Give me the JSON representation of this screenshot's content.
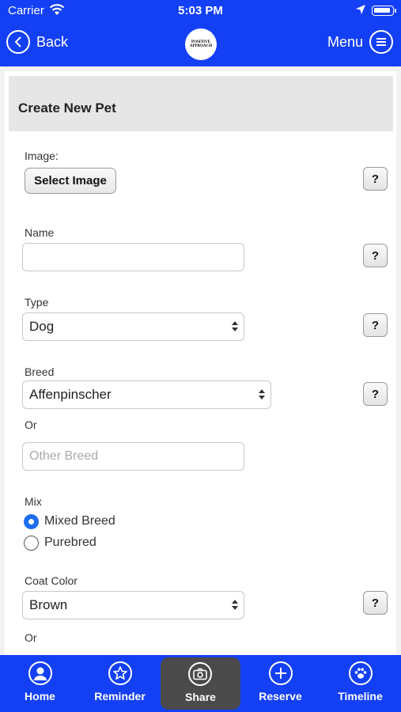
{
  "status": {
    "carrier": "Carrier",
    "time": "5:03 PM"
  },
  "nav": {
    "back_label": "Back",
    "menu_label": "Menu",
    "logo_text": "POSITIVE APPROACH"
  },
  "page": {
    "title": "Create New Pet"
  },
  "form": {
    "image_label": "Image:",
    "select_image_label": "Select Image",
    "name_label": "Name",
    "name_value": "",
    "type_label": "Type",
    "type_value": "Dog",
    "breed_label": "Breed",
    "breed_value": "Affenpinscher",
    "or_label": "Or",
    "other_breed_placeholder": "Other Breed",
    "mix_label": "Mix",
    "mix_options": [
      {
        "label": "Mixed Breed",
        "selected": true
      },
      {
        "label": "Purebred",
        "selected": false
      }
    ],
    "coat_color_label": "Coat Color",
    "coat_color_value": "Brown",
    "or_label_2": "Or",
    "help_label": "?"
  },
  "tabs": [
    {
      "label": "Home",
      "icon": "person-icon"
    },
    {
      "label": "Reminder",
      "icon": "star-icon"
    },
    {
      "label": "Share",
      "icon": "camera-icon",
      "active": true
    },
    {
      "label": "Reserve",
      "icon": "plus-icon"
    },
    {
      "label": "Timeline",
      "icon": "paw-icon"
    }
  ],
  "colors": {
    "brand_blue": "#1440f5",
    "radio_blue": "#1e6cf0",
    "active_tab": "#4a4a4a"
  }
}
